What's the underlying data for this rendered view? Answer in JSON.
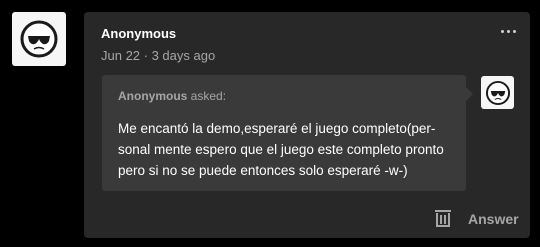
{
  "post": {
    "author": "Anonymous",
    "meta": "Jun 22 · 3 days ago",
    "author_avatar_icon": "anonymous-sunglasses-face-icon",
    "more_icon": "more-options-icon"
  },
  "ask": {
    "asker": "Anonymous",
    "asked_suffix": " asked:",
    "question": "Me encantó la demo,esperaré el juego completo(per-sonal mente espero que el juego este completo pronto pero si no se puede entonces solo esperaré -w-)",
    "question_lines": [
      "Me encantó la demo,esperaré el juego completo(per-",
      "sonal mente espero que el juego este completo pronto",
      "pero si no se puede entonces solo esperaré -w-)"
    ],
    "asker_avatar_icon": "anonymous-sunglasses-face-icon"
  },
  "actions": {
    "delete_icon": "trash-icon",
    "answer_label": "Answer"
  },
  "colors": {
    "page_background": "#000000",
    "card_background": "#282828",
    "bubble_background": "#3a3a3a",
    "primary_text": "#ffffff",
    "secondary_text": "#a6a6a6"
  }
}
